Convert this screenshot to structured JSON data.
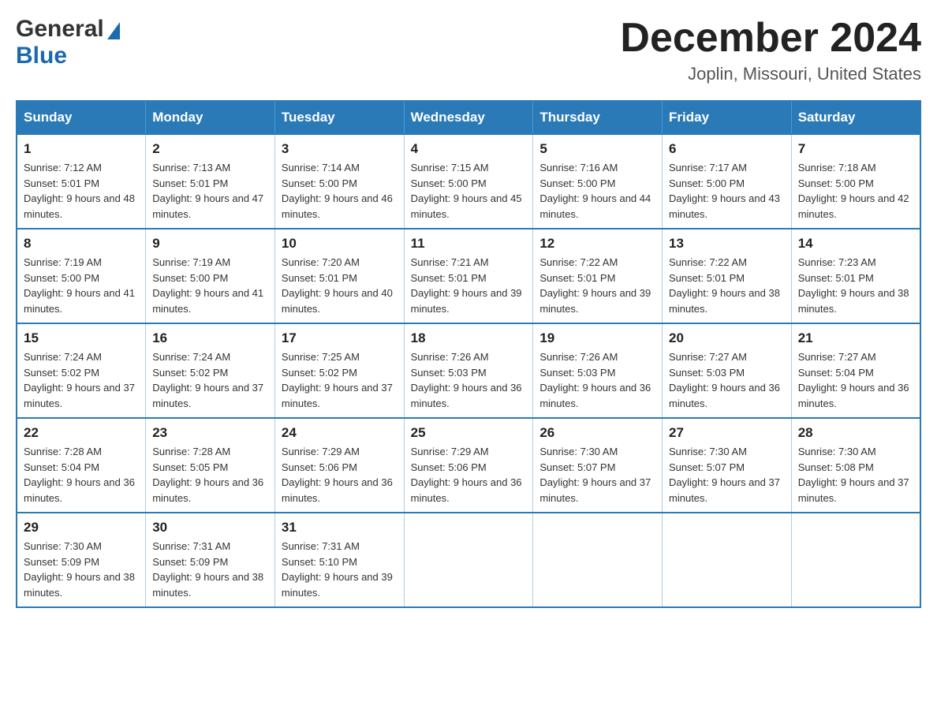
{
  "header": {
    "logo_general": "General",
    "logo_blue": "Blue",
    "month_title": "December 2024",
    "location": "Joplin, Missouri, United States"
  },
  "days_of_week": [
    "Sunday",
    "Monday",
    "Tuesday",
    "Wednesday",
    "Thursday",
    "Friday",
    "Saturday"
  ],
  "weeks": [
    [
      {
        "day": "1",
        "sunrise": "Sunrise: 7:12 AM",
        "sunset": "Sunset: 5:01 PM",
        "daylight": "Daylight: 9 hours and 48 minutes."
      },
      {
        "day": "2",
        "sunrise": "Sunrise: 7:13 AM",
        "sunset": "Sunset: 5:01 PM",
        "daylight": "Daylight: 9 hours and 47 minutes."
      },
      {
        "day": "3",
        "sunrise": "Sunrise: 7:14 AM",
        "sunset": "Sunset: 5:00 PM",
        "daylight": "Daylight: 9 hours and 46 minutes."
      },
      {
        "day": "4",
        "sunrise": "Sunrise: 7:15 AM",
        "sunset": "Sunset: 5:00 PM",
        "daylight": "Daylight: 9 hours and 45 minutes."
      },
      {
        "day": "5",
        "sunrise": "Sunrise: 7:16 AM",
        "sunset": "Sunset: 5:00 PM",
        "daylight": "Daylight: 9 hours and 44 minutes."
      },
      {
        "day": "6",
        "sunrise": "Sunrise: 7:17 AM",
        "sunset": "Sunset: 5:00 PM",
        "daylight": "Daylight: 9 hours and 43 minutes."
      },
      {
        "day": "7",
        "sunrise": "Sunrise: 7:18 AM",
        "sunset": "Sunset: 5:00 PM",
        "daylight": "Daylight: 9 hours and 42 minutes."
      }
    ],
    [
      {
        "day": "8",
        "sunrise": "Sunrise: 7:19 AM",
        "sunset": "Sunset: 5:00 PM",
        "daylight": "Daylight: 9 hours and 41 minutes."
      },
      {
        "day": "9",
        "sunrise": "Sunrise: 7:19 AM",
        "sunset": "Sunset: 5:00 PM",
        "daylight": "Daylight: 9 hours and 41 minutes."
      },
      {
        "day": "10",
        "sunrise": "Sunrise: 7:20 AM",
        "sunset": "Sunset: 5:01 PM",
        "daylight": "Daylight: 9 hours and 40 minutes."
      },
      {
        "day": "11",
        "sunrise": "Sunrise: 7:21 AM",
        "sunset": "Sunset: 5:01 PM",
        "daylight": "Daylight: 9 hours and 39 minutes."
      },
      {
        "day": "12",
        "sunrise": "Sunrise: 7:22 AM",
        "sunset": "Sunset: 5:01 PM",
        "daylight": "Daylight: 9 hours and 39 minutes."
      },
      {
        "day": "13",
        "sunrise": "Sunrise: 7:22 AM",
        "sunset": "Sunset: 5:01 PM",
        "daylight": "Daylight: 9 hours and 38 minutes."
      },
      {
        "day": "14",
        "sunrise": "Sunrise: 7:23 AM",
        "sunset": "Sunset: 5:01 PM",
        "daylight": "Daylight: 9 hours and 38 minutes."
      }
    ],
    [
      {
        "day": "15",
        "sunrise": "Sunrise: 7:24 AM",
        "sunset": "Sunset: 5:02 PM",
        "daylight": "Daylight: 9 hours and 37 minutes."
      },
      {
        "day": "16",
        "sunrise": "Sunrise: 7:24 AM",
        "sunset": "Sunset: 5:02 PM",
        "daylight": "Daylight: 9 hours and 37 minutes."
      },
      {
        "day": "17",
        "sunrise": "Sunrise: 7:25 AM",
        "sunset": "Sunset: 5:02 PM",
        "daylight": "Daylight: 9 hours and 37 minutes."
      },
      {
        "day": "18",
        "sunrise": "Sunrise: 7:26 AM",
        "sunset": "Sunset: 5:03 PM",
        "daylight": "Daylight: 9 hours and 36 minutes."
      },
      {
        "day": "19",
        "sunrise": "Sunrise: 7:26 AM",
        "sunset": "Sunset: 5:03 PM",
        "daylight": "Daylight: 9 hours and 36 minutes."
      },
      {
        "day": "20",
        "sunrise": "Sunrise: 7:27 AM",
        "sunset": "Sunset: 5:03 PM",
        "daylight": "Daylight: 9 hours and 36 minutes."
      },
      {
        "day": "21",
        "sunrise": "Sunrise: 7:27 AM",
        "sunset": "Sunset: 5:04 PM",
        "daylight": "Daylight: 9 hours and 36 minutes."
      }
    ],
    [
      {
        "day": "22",
        "sunrise": "Sunrise: 7:28 AM",
        "sunset": "Sunset: 5:04 PM",
        "daylight": "Daylight: 9 hours and 36 minutes."
      },
      {
        "day": "23",
        "sunrise": "Sunrise: 7:28 AM",
        "sunset": "Sunset: 5:05 PM",
        "daylight": "Daylight: 9 hours and 36 minutes."
      },
      {
        "day": "24",
        "sunrise": "Sunrise: 7:29 AM",
        "sunset": "Sunset: 5:06 PM",
        "daylight": "Daylight: 9 hours and 36 minutes."
      },
      {
        "day": "25",
        "sunrise": "Sunrise: 7:29 AM",
        "sunset": "Sunset: 5:06 PM",
        "daylight": "Daylight: 9 hours and 36 minutes."
      },
      {
        "day": "26",
        "sunrise": "Sunrise: 7:30 AM",
        "sunset": "Sunset: 5:07 PM",
        "daylight": "Daylight: 9 hours and 37 minutes."
      },
      {
        "day": "27",
        "sunrise": "Sunrise: 7:30 AM",
        "sunset": "Sunset: 5:07 PM",
        "daylight": "Daylight: 9 hours and 37 minutes."
      },
      {
        "day": "28",
        "sunrise": "Sunrise: 7:30 AM",
        "sunset": "Sunset: 5:08 PM",
        "daylight": "Daylight: 9 hours and 37 minutes."
      }
    ],
    [
      {
        "day": "29",
        "sunrise": "Sunrise: 7:30 AM",
        "sunset": "Sunset: 5:09 PM",
        "daylight": "Daylight: 9 hours and 38 minutes."
      },
      {
        "day": "30",
        "sunrise": "Sunrise: 7:31 AM",
        "sunset": "Sunset: 5:09 PM",
        "daylight": "Daylight: 9 hours and 38 minutes."
      },
      {
        "day": "31",
        "sunrise": "Sunrise: 7:31 AM",
        "sunset": "Sunset: 5:10 PM",
        "daylight": "Daylight: 9 hours and 39 minutes."
      },
      null,
      null,
      null,
      null
    ]
  ]
}
